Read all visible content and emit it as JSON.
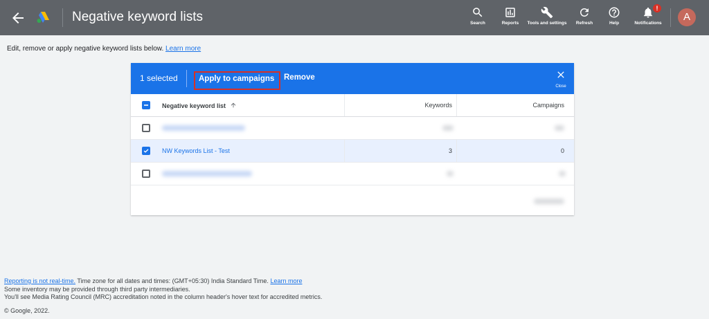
{
  "header": {
    "title": "Negative keyword lists",
    "tools": [
      {
        "label": "Search",
        "icon": "search-icon"
      },
      {
        "label": "Reports",
        "icon": "reports-icon"
      },
      {
        "label": "Tools and settings",
        "icon": "wrench-icon"
      },
      {
        "label": "Refresh",
        "icon": "refresh-icon"
      },
      {
        "label": "Help",
        "icon": "help-icon"
      },
      {
        "label": "Notifications",
        "icon": "bell-icon",
        "badge": "!"
      }
    ],
    "avatar_initial": "A"
  },
  "intro": {
    "text": "Edit, remove or apply negative keyword lists below.",
    "link": "Learn more"
  },
  "selection_bar": {
    "count": "1 selected",
    "apply_label": "Apply to campaigns",
    "remove_label": "Remove",
    "close_label": "Close"
  },
  "table": {
    "columns": [
      "Negative keyword list",
      "Keywords",
      "Campaigns"
    ],
    "sort_icon": "arrow-up-icon",
    "rows": [
      {
        "name": "",
        "keywords": "",
        "campaigns": "",
        "checked": false,
        "blurred": true
      },
      {
        "name": "NW Keywords List - Test",
        "keywords": "3",
        "campaigns": "0",
        "checked": true,
        "blurred": false
      },
      {
        "name": "",
        "keywords": "",
        "campaigns": "",
        "checked": false,
        "blurred": true
      }
    ]
  },
  "footer": {
    "realtime_link": "Reporting is not real-time.",
    "timezone": " Time zone for all dates and times: (GMT+05:30) India Standard Time. ",
    "timezone_link": "Learn more",
    "line2": "Some inventory may be provided through third party intermediaries.",
    "line3": "You'll see Media Rating Council (MRC) accreditation noted in the column header's hover text for accredited metrics.",
    "copyright": "© Google, 2022."
  },
  "colors": {
    "topbar": "#5f6368",
    "selection_bar": "#1a73e8",
    "highlight_box": "#d93025",
    "link": "#1a73e8",
    "selected_row": "#e8f0fe"
  }
}
